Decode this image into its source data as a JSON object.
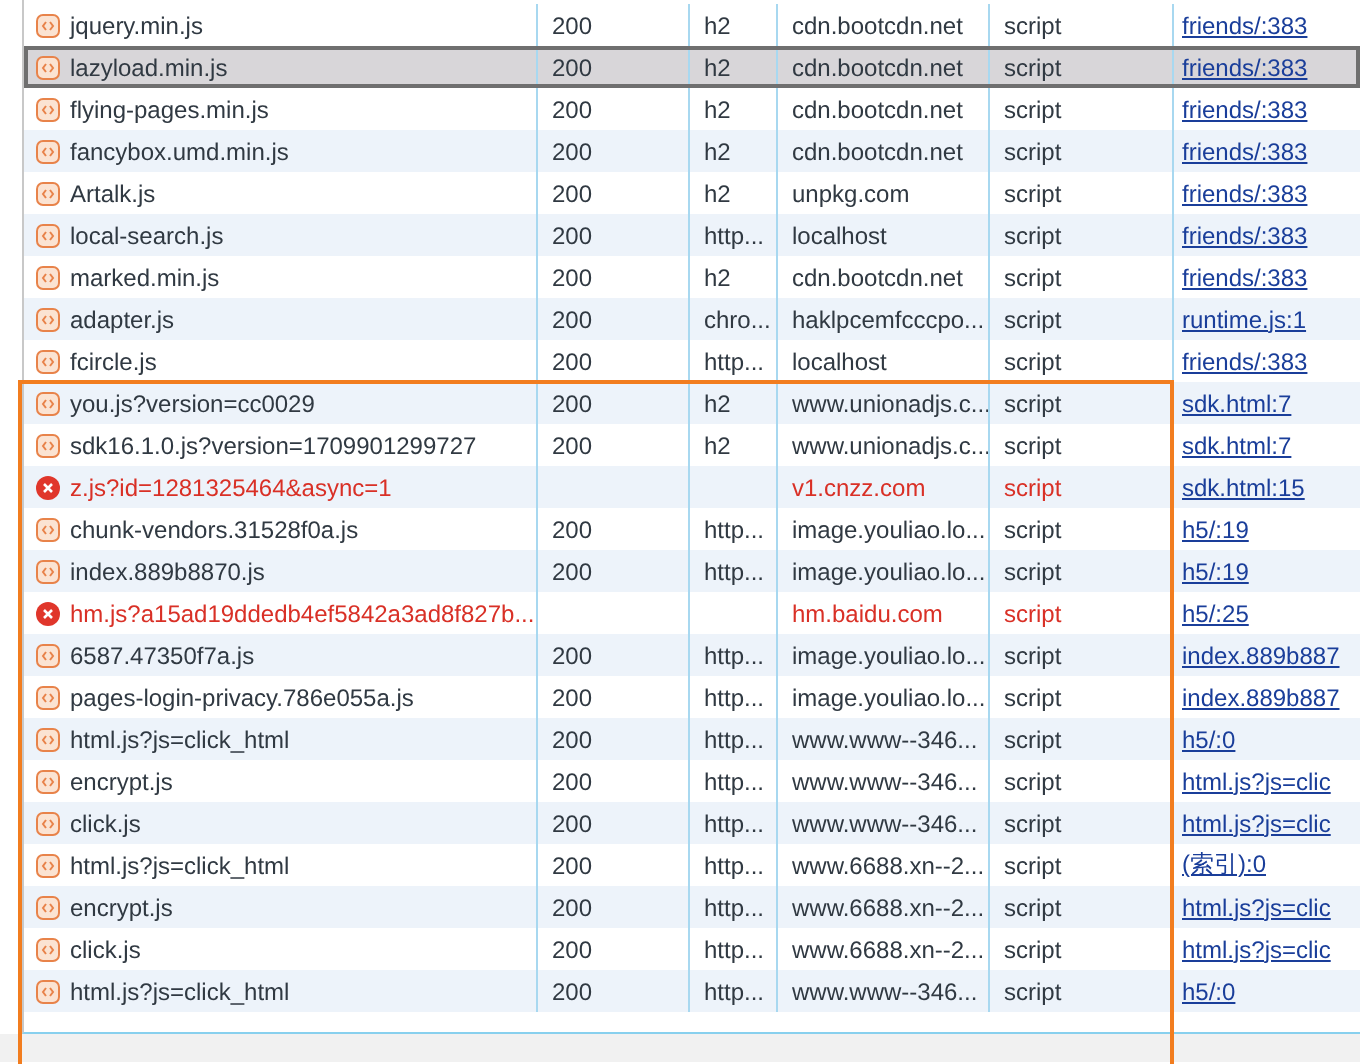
{
  "requests": [
    {
      "name": "jquery.min.js",
      "status": "200",
      "protocol": "h2",
      "domain": "cdn.bootcdn.net",
      "type": "script",
      "initiator": "friends/:383",
      "error": false,
      "selected": false
    },
    {
      "name": "lazyload.min.js",
      "status": "200",
      "protocol": "h2",
      "domain": "cdn.bootcdn.net",
      "type": "script",
      "initiator": "friends/:383",
      "error": false,
      "selected": true
    },
    {
      "name": "flying-pages.min.js",
      "status": "200",
      "protocol": "h2",
      "domain": "cdn.bootcdn.net",
      "type": "script",
      "initiator": "friends/:383",
      "error": false,
      "selected": false
    },
    {
      "name": "fancybox.umd.min.js",
      "status": "200",
      "protocol": "h2",
      "domain": "cdn.bootcdn.net",
      "type": "script",
      "initiator": "friends/:383",
      "error": false,
      "selected": false
    },
    {
      "name": "Artalk.js",
      "status": "200",
      "protocol": "h2",
      "domain": "unpkg.com",
      "type": "script",
      "initiator": "friends/:383",
      "error": false,
      "selected": false
    },
    {
      "name": "local-search.js",
      "status": "200",
      "protocol": "http...",
      "domain": "localhost",
      "type": "script",
      "initiator": "friends/:383",
      "error": false,
      "selected": false
    },
    {
      "name": "marked.min.js",
      "status": "200",
      "protocol": "h2",
      "domain": "cdn.bootcdn.net",
      "type": "script",
      "initiator": "friends/:383",
      "error": false,
      "selected": false
    },
    {
      "name": "adapter.js",
      "status": "200",
      "protocol": "chro...",
      "domain": "haklpcemfcccpo...",
      "type": "script",
      "initiator": "runtime.js:1",
      "error": false,
      "selected": false
    },
    {
      "name": "fcircle.js",
      "status": "200",
      "protocol": "http...",
      "domain": "localhost",
      "type": "script",
      "initiator": "friends/:383",
      "error": false,
      "selected": false
    },
    {
      "name": "you.js?version=cc0029",
      "status": "200",
      "protocol": "h2",
      "domain": "www.unionadjs.c...",
      "type": "script",
      "initiator": "sdk.html:7",
      "error": false,
      "selected": false
    },
    {
      "name": "sdk16.1.0.js?version=1709901299727",
      "status": "200",
      "protocol": "h2",
      "domain": "www.unionadjs.c...",
      "type": "script",
      "initiator": "sdk.html:7",
      "error": false,
      "selected": false
    },
    {
      "name": "z.js?id=1281325464&async=1",
      "domain": "v1.cnzz.com",
      "type": "script",
      "initiator": "sdk.html:15",
      "error": true,
      "selected": false
    },
    {
      "name": "chunk-vendors.31528f0a.js",
      "status": "200",
      "protocol": "http...",
      "domain": "image.youliao.lo...",
      "type": "script",
      "initiator": "h5/:19",
      "error": false,
      "selected": false
    },
    {
      "name": "index.889b8870.js",
      "status": "200",
      "protocol": "http...",
      "domain": "image.youliao.lo...",
      "type": "script",
      "initiator": "h5/:19",
      "error": false,
      "selected": false
    },
    {
      "name": "hm.js?a15ad19ddedb4ef5842a3ad8f827b...",
      "domain": "hm.baidu.com",
      "type": "script",
      "initiator": "h5/:25",
      "error": true,
      "selected": false
    },
    {
      "name": "6587.47350f7a.js",
      "status": "200",
      "protocol": "http...",
      "domain": "image.youliao.lo...",
      "type": "script",
      "initiator": "index.889b887",
      "error": false,
      "selected": false
    },
    {
      "name": "pages-login-privacy.786e055a.js",
      "status": "200",
      "protocol": "http...",
      "domain": "image.youliao.lo...",
      "type": "script",
      "initiator": "index.889b887",
      "error": false,
      "selected": false
    },
    {
      "name": "html.js?js=click_html",
      "status": "200",
      "protocol": "http...",
      "domain": "www.www--346...",
      "type": "script",
      "initiator": "h5/:0",
      "error": false,
      "selected": false
    },
    {
      "name": "encrypt.js",
      "status": "200",
      "protocol": "http...",
      "domain": "www.www--346...",
      "type": "script",
      "initiator": "html.js?js=clic",
      "error": false,
      "selected": false
    },
    {
      "name": "click.js",
      "status": "200",
      "protocol": "http...",
      "domain": "www.www--346...",
      "type": "script",
      "initiator": "html.js?js=clic",
      "error": false,
      "selected": false
    },
    {
      "name": "html.js?js=click_html",
      "status": "200",
      "protocol": "http...",
      "domain": "www.6688.xn--2...",
      "type": "script",
      "initiator": "(索引):0",
      "error": false,
      "selected": false
    },
    {
      "name": "encrypt.js",
      "status": "200",
      "protocol": "http...",
      "domain": "www.6688.xn--2...",
      "type": "script",
      "initiator": "html.js?js=clic",
      "error": false,
      "selected": false
    },
    {
      "name": "click.js",
      "status": "200",
      "protocol": "http...",
      "domain": "www.6688.xn--2...",
      "type": "script",
      "initiator": "html.js?js=clic",
      "error": false,
      "selected": false
    },
    {
      "name": "html.js?js=click_html",
      "status": "200",
      "protocol": "http...",
      "domain": "www.www--346...",
      "type": "script",
      "initiator": "h5/:0",
      "error": false,
      "selected": false
    }
  ]
}
